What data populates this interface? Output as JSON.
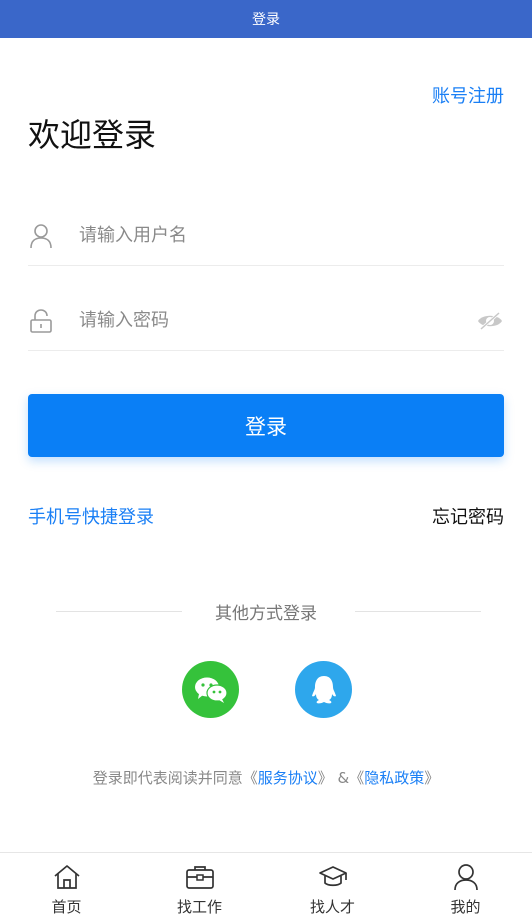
{
  "header": {
    "title": "登录"
  },
  "top": {
    "register_link": "账号注册",
    "welcome": "欢迎登录"
  },
  "form": {
    "username_placeholder": "请输入用户名",
    "password_placeholder": "请输入密码",
    "login_button": "登录"
  },
  "links": {
    "phone_login": "手机号快捷登录",
    "forgot_password": "忘记密码"
  },
  "other": {
    "label": "其他方式登录",
    "options": [
      {
        "name": "wechat",
        "icon": "wechat-icon",
        "color": "#35c23b"
      },
      {
        "name": "qq",
        "icon": "qq-icon",
        "color": "#2ea7ec"
      }
    ]
  },
  "agreement": {
    "prefix": "登录即代表阅读并同意",
    "open1": "《",
    "terms": "服务协议",
    "close1": "》",
    "and": " &",
    "open2": "《",
    "privacy": "隐私政策",
    "close2": "》"
  },
  "tabbar": {
    "items": [
      {
        "label": "首页",
        "icon": "home-icon"
      },
      {
        "label": "找工作",
        "icon": "briefcase-icon"
      },
      {
        "label": "找人才",
        "icon": "graduation-cap-icon"
      },
      {
        "label": "我的",
        "icon": "user-icon"
      }
    ]
  },
  "colors": {
    "header_bg": "#3a67c9",
    "accent": "#0a7ff6",
    "link": "#1a7ff5"
  }
}
